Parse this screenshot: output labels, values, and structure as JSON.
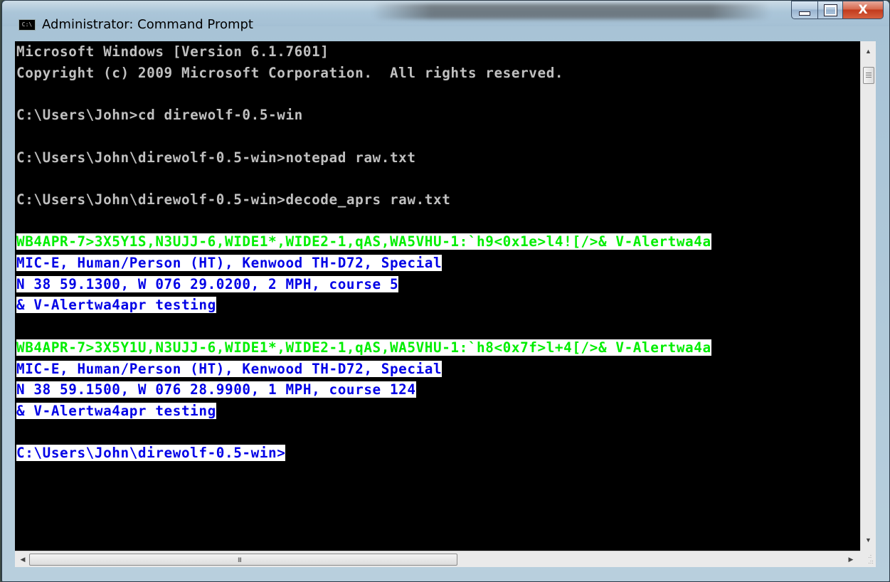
{
  "window": {
    "title": "Administrator: Command Prompt",
    "icon_label": "C:\\",
    "close_glyph": "X"
  },
  "console": {
    "lines": [
      {
        "text": "Microsoft Windows [Version 6.1.7601]",
        "style": "plain"
      },
      {
        "text": "Copyright (c) 2009 Microsoft Corporation.  All rights reserved.",
        "style": "plain"
      },
      {
        "text": "",
        "style": "plain"
      },
      {
        "text": "C:\\Users\\John>cd direwolf-0.5-win",
        "style": "plain"
      },
      {
        "text": "",
        "style": "plain"
      },
      {
        "text": "C:\\Users\\John\\direwolf-0.5-win>notepad raw.txt",
        "style": "plain"
      },
      {
        "text": "",
        "style": "plain"
      },
      {
        "text": "C:\\Users\\John\\direwolf-0.5-win>decode_aprs raw.txt",
        "style": "plain"
      },
      {
        "text": "",
        "style": "plain"
      },
      {
        "text": "WB4APR-7>3X5Y1S,N3UJJ-6,WIDE1*,WIDE2-1,qAS,WA5VHU-1:`h9<0x1e>l4![/>& V-Alertwa4a",
        "style": "green"
      },
      {
        "text": "MIC-E, Human/Person (HT), Kenwood TH-D72, Special",
        "style": "blue"
      },
      {
        "text": "N 38 59.1300, W 076 29.0200, 2 MPH, course 5",
        "style": "blue"
      },
      {
        "text": "& V-Alertwa4apr testing",
        "style": "blue"
      },
      {
        "text": "",
        "style": "plain"
      },
      {
        "text": "WB4APR-7>3X5Y1U,N3UJJ-6,WIDE1*,WIDE2-1,qAS,WA5VHU-1:`h8<0x7f>l+4[/>& V-Alertwa4a",
        "style": "green"
      },
      {
        "text": "MIC-E, Human/Person (HT), Kenwood TH-D72, Special",
        "style": "blue"
      },
      {
        "text": "N 38 59.1500, W 076 28.9900, 1 MPH, course 124",
        "style": "blue"
      },
      {
        "text": "& V-Alertwa4apr testing",
        "style": "blue"
      },
      {
        "text": "",
        "style": "plain"
      },
      {
        "text": "C:\\Users\\John\\direwolf-0.5-win>",
        "style": "blue"
      }
    ]
  },
  "scrollbar": {
    "up_arrow": "▲",
    "down_arrow": "▼",
    "left_arrow": "◀",
    "right_arrow": "▶",
    "h_grip": "III"
  },
  "colors": {
    "console_bg": "#000000",
    "console_fg": "#c0c0c0",
    "highlight_bg": "#ffffff",
    "green_fg": "#00ee00",
    "blue_fg": "#0000e6"
  }
}
